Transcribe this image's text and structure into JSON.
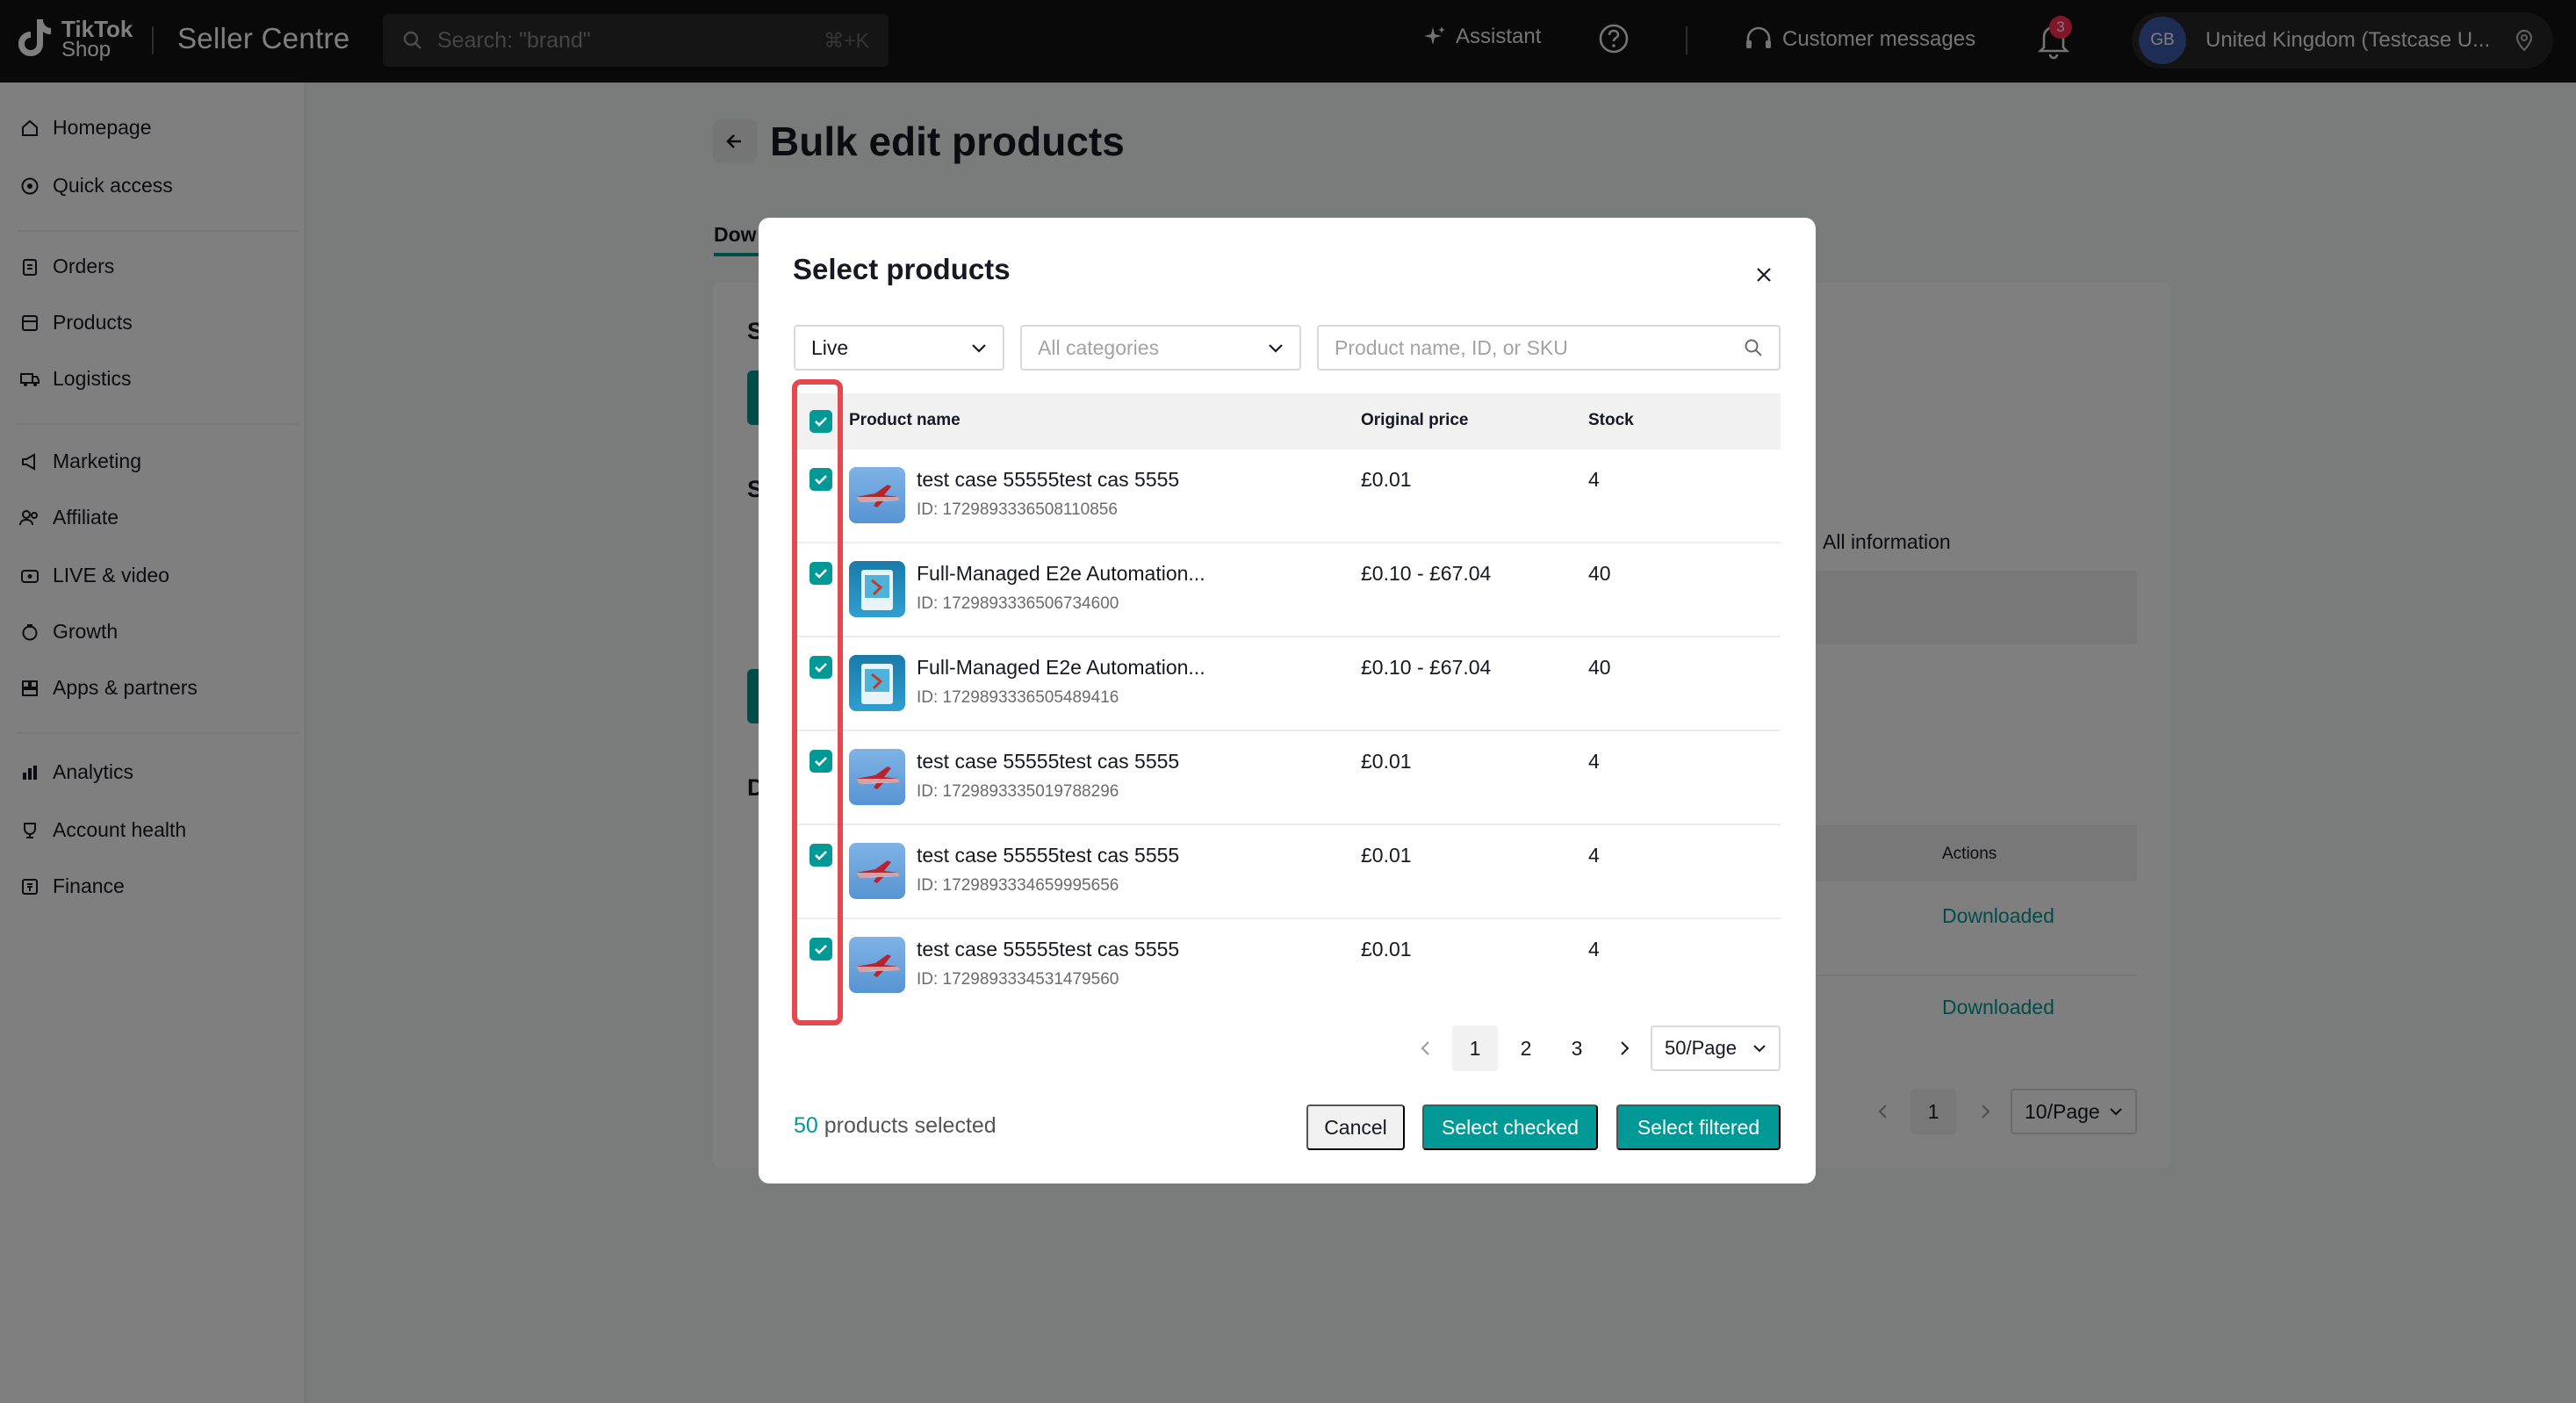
{
  "topbar": {
    "logo_line1": "TikTok",
    "logo_line2": "Shop",
    "app_title": "Seller Centre",
    "search_placeholder": "Search: \"brand\"",
    "search_shortcut": "⌘+K",
    "assistant_label": "Assistant",
    "customer_messages_label": "Customer messages",
    "notification_count": "3",
    "avatar_initials": "GB",
    "account_label": "United Kingdom  (Testcase U..."
  },
  "sidebar": {
    "items": [
      {
        "label": "Homepage",
        "icon": "home-icon"
      },
      {
        "label": "Quick access",
        "icon": "compass-icon"
      },
      {
        "label": "Orders",
        "icon": "clipboard-icon"
      },
      {
        "label": "Products",
        "icon": "box-icon"
      },
      {
        "label": "Logistics",
        "icon": "truck-icon"
      },
      {
        "label": "Marketing",
        "icon": "megaphone-icon"
      },
      {
        "label": "Affiliate",
        "icon": "people-icon"
      },
      {
        "label": "LIVE & video",
        "icon": "live-icon"
      },
      {
        "label": "Growth",
        "icon": "growth-icon"
      },
      {
        "label": "Apps & partners",
        "icon": "apps-icon"
      },
      {
        "label": "Analytics",
        "icon": "chart-icon"
      },
      {
        "label": "Account health",
        "icon": "trophy-icon"
      },
      {
        "label": "Finance",
        "icon": "finance-icon"
      }
    ]
  },
  "page": {
    "title": "Bulk edit products",
    "tab_partial": "Dow",
    "letter_s1": "S",
    "letter_s2": "S",
    "letter_d": "D",
    "all_information": "All information",
    "actions_header": "Actions",
    "downloaded_1": "Downloaded",
    "downloaded_2": "Downloaded",
    "bg_page_current": "1",
    "bg_page_size": "10/Page"
  },
  "modal": {
    "title": "Select products",
    "status_filter": "Live",
    "category_placeholder": "All categories",
    "search_placeholder": "Product name, ID, or SKU",
    "columns": {
      "name": "Product name",
      "price": "Original price",
      "stock": "Stock"
    },
    "rows": [
      {
        "name": "test case 55555test cas 5555",
        "id": "ID: 1729893336508110856",
        "price": "£0.01",
        "stock": "4",
        "thumb": "plane"
      },
      {
        "name": "Full-Managed E2e Automation...",
        "id": "ID: 1729893336506734600",
        "price": "£0.10 - £67.04",
        "stock": "40",
        "thumb": "book"
      },
      {
        "name": "Full-Managed E2e Automation...",
        "id": "ID: 1729893336505489416",
        "price": "£0.10 - £67.04",
        "stock": "40",
        "thumb": "book"
      },
      {
        "name": "test case 55555test cas 5555",
        "id": "ID: 1729893335019788296",
        "price": "£0.01",
        "stock": "4",
        "thumb": "plane"
      },
      {
        "name": "test case 55555test cas 5555",
        "id": "ID: 1729893334659995656",
        "price": "£0.01",
        "stock": "4",
        "thumb": "plane"
      },
      {
        "name": "test case 55555test cas 5555",
        "id": "ID: 1729893334531479560",
        "price": "£0.01",
        "stock": "4",
        "thumb": "plane"
      }
    ],
    "pagination": {
      "pages": [
        "1",
        "2",
        "3"
      ],
      "current": "1",
      "page_size": "50/Page"
    },
    "selected_count": "50",
    "selected_suffix": " products selected",
    "cancel_label": "Cancel",
    "select_checked_label": "Select checked",
    "select_filtered_label": "Select filtered"
  },
  "colors": {
    "accent": "#009995",
    "highlight": "#e5484d",
    "topbar": "#121212",
    "badge": "#fe2c55"
  }
}
